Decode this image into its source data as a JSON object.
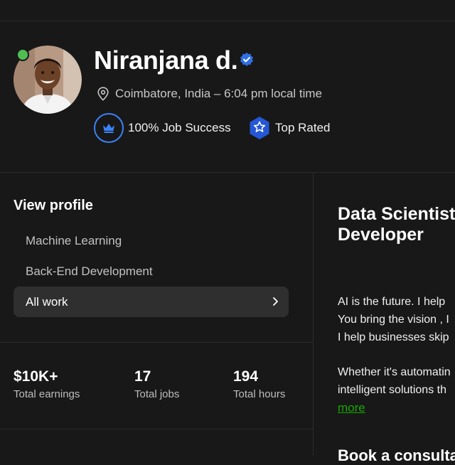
{
  "profile": {
    "name": "Niranjana d.",
    "location": "Coimbatore, India – 6:04 pm local time",
    "job_success": "100% Job Success",
    "top_rated": "Top Rated",
    "status_color": "#4fbd52",
    "accent_color": "#3b82f6"
  },
  "sidebar": {
    "view_profile": "View profile",
    "specializations": [
      "Machine Learning",
      "Back-End Development"
    ],
    "all_work": "All work"
  },
  "stats": [
    {
      "value": "$10K+",
      "label": "Total earnings"
    },
    {
      "value": "17",
      "label": "Total jobs"
    },
    {
      "value": "194",
      "label": "Total hours"
    }
  ],
  "main": {
    "title_lines": [
      "Data Scientist/",
      "Developer"
    ],
    "paragraph1": [
      "AI is the future. I help",
      "You bring the vision , I",
      "I help businesses skip"
    ],
    "paragraph2": [
      "Whether it's automatin",
      "intelligent solutions th"
    ],
    "more_link": "more",
    "next_heading": "Book a consultati"
  },
  "icons": {
    "online": "online-status-dot",
    "verified": "verified-badge-icon",
    "location": "location-pin-icon",
    "job_success": "crown-icon",
    "top_rated": "star-badge-icon",
    "chevron": "chevron-right-icon"
  }
}
